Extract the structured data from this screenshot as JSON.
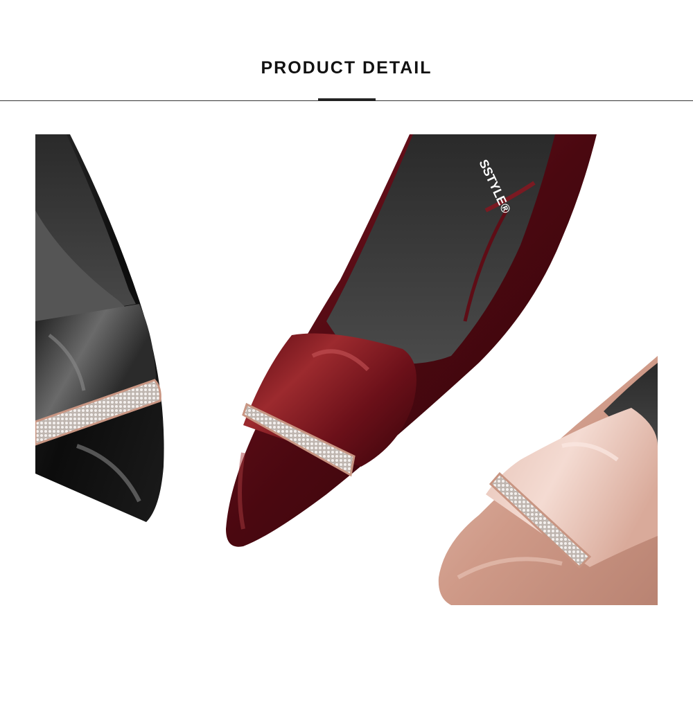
{
  "header": {
    "title": "PRODUCT DETAIL"
  },
  "photo": {
    "insole_brand": "SSTYLE®",
    "shoe_colors": {
      "black": "#141414",
      "burgundy": "#5e0d16",
      "nude": "#d6a594"
    }
  }
}
